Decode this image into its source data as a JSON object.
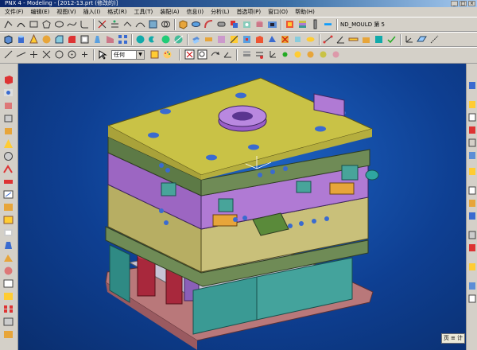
{
  "window": {
    "title": "PNX 4 - Modeling - [2012-13.prt (修改的)]",
    "buttons": [
      "_",
      "□",
      "×"
    ]
  },
  "menu": {
    "items": [
      "文件(F)",
      "编辑(E)",
      "视图(V)",
      "插入(I)",
      "格式(R)",
      "工具(T)",
      "装配(A)",
      "信息(I)",
      "分析(L)",
      "首选项(P)",
      "窗口(O)",
      "帮助(H)"
    ]
  },
  "toolbar3": {
    "select_filter": "任何"
  },
  "right_tag": "ND_MOULD 第 5",
  "statusbox": {
    "text": "页 ≡ 计"
  },
  "colors": {
    "viewport_bg": "#0e3f92",
    "plate_top": "#c9c246",
    "plate_purple": "#b07ad4",
    "plate_yellow": "#c9c07a",
    "plate_green": "#6f8b56",
    "plate_teal": "#3a9a94",
    "base_pink": "#b9787a",
    "pillar_red": "#a8283c"
  },
  "icons": {
    "left_toolbar": [
      "cube-icon",
      "hole-icon",
      "boss-icon",
      "block-icon",
      "cylinder-icon",
      "cone-icon",
      "sphere-icon",
      "extrude-icon",
      "revolve-icon",
      "sweep-icon",
      "blend-icon",
      "chamfer-icon",
      "shell-icon",
      "draft-icon",
      "trim-icon",
      "unite-icon",
      "subtract-icon",
      "intersect-icon",
      "pattern-icon",
      "mirror-icon",
      "offset-icon",
      "sew-icon",
      "split-icon",
      "thicken-icon",
      "measure-icon",
      "datum-icon",
      "axis-icon",
      "sketch-icon",
      "layer-icon"
    ],
    "right_toolbar": [
      "pan-icon",
      "zoom-icon",
      "rotate-icon",
      "fit-icon",
      "wireframe-icon",
      "shaded-icon",
      "front-view-icon",
      "top-view-icon",
      "right-view-icon",
      "iso-view-icon",
      "section-icon",
      "render-icon",
      "lights-icon",
      "background-icon",
      "snap-icon"
    ]
  }
}
